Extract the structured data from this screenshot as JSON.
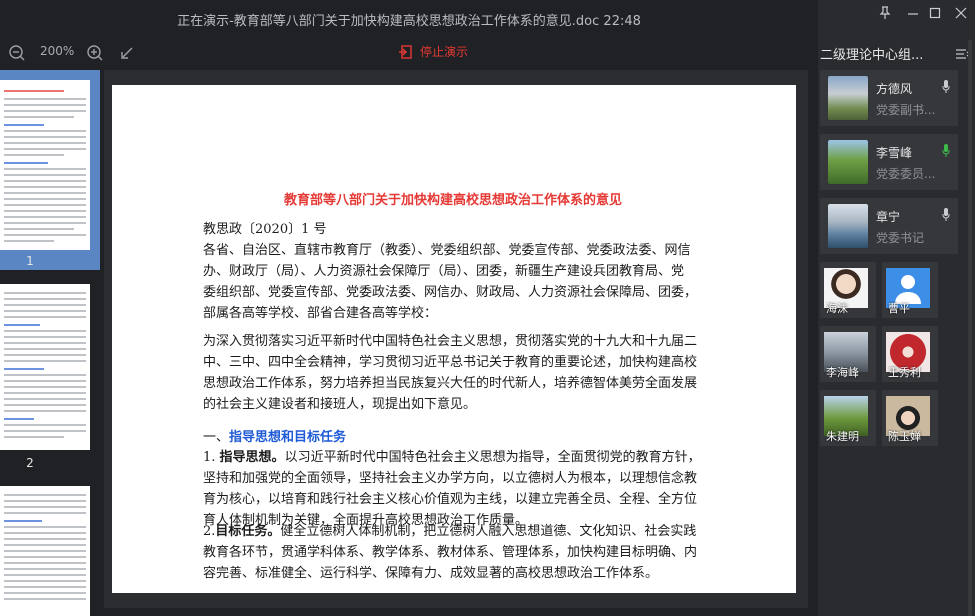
{
  "window": {
    "title": "正在演示-教育部等八部门关于加快构建高校思想政治工作体系的意见.doc 22:48"
  },
  "toolbar": {
    "zoom": "200%",
    "stop_label": "停止演示"
  },
  "thumbnails": [
    {
      "page": "1"
    },
    {
      "page": "2"
    }
  ],
  "document": {
    "title": "教育部等八部门关于加快构建高校思想政治工作体系的意见",
    "ref": "教思政〔2020〕1 号",
    "recipients": [
      "各省、自治区、直辖市教育厅（教委）、党委组织部、党委宣传部、党委政法委、网信",
      "办、财政厅（局）、人力资源社会保障厅（局）、团委，新疆生产建设兵团教育局、党",
      "委组织部、党委宣传部、党委政法委、网信办、财政局、人力资源社会保障局、团委，",
      "部属各高等学校、部省合建各高等学校："
    ],
    "intro": [
      "为深入贯彻落实习近平新时代中国特色社会主义思想，贯彻落实党的十九大和十九届二",
      "中、三中、四中全会精神，学习贯彻习近平总书记关于教育的重要论述，加快构建高校",
      "思想政治工作体系，努力培养担当民族复兴大任的时代新人，培养德智体美劳全面发展",
      "的社会主义建设者和接班人，现提出如下意见。"
    ],
    "section1_num": "一、",
    "section1_title": "指导思想和目标任务",
    "item1_num": "1.",
    "item1_head": "指导思想。",
    "item1_lines": [
      "以习近平新时代中国特色社会主义思想为指导，全面贯彻党的教育方针，",
      "坚持和加强党的全面领导，坚持社会主义办学方向，以立德树人为根本，以理想信念教",
      "育为核心，以培育和践行社会主义核心价值观为主线，以建立完善全员、全程、全方位",
      "育人体制机制为关键，全面提升高校思想政治工作质量。"
    ],
    "item2_num": "2.",
    "item2_head": "目标任务。",
    "item2_lines": [
      "健全立德树人体制机制，把立德树人融入思想道德、文化知识、社会实践",
      "教育各环节，贯通学科体系、教学体系、教材体系、管理体系，加快构建目标明确、内",
      "容完善、标准健全、运行科学、保障有力、成效显著的高校思想政治工作体系。"
    ]
  },
  "panel": {
    "title": "二级理论中心组...",
    "speakers": [
      {
        "name": "方德风",
        "role": "党委副书...",
        "mic_color": "#c9ccd1"
      },
      {
        "name": "李雪峰",
        "role": "党委委员...",
        "mic_color": "#3dbb4a"
      },
      {
        "name": "章宁",
        "role": "党委书记",
        "mic_color": "#c9ccd1"
      }
    ],
    "attendees": [
      "海沫",
      "曹平",
      "李海峰",
      "王秀利",
      "朱建明",
      "陈玉婵"
    ]
  },
  "colors": {
    "accent_red": "#e53935",
    "heading_blue": "#1f5bd6",
    "mic_active": "#3dbb4a"
  }
}
